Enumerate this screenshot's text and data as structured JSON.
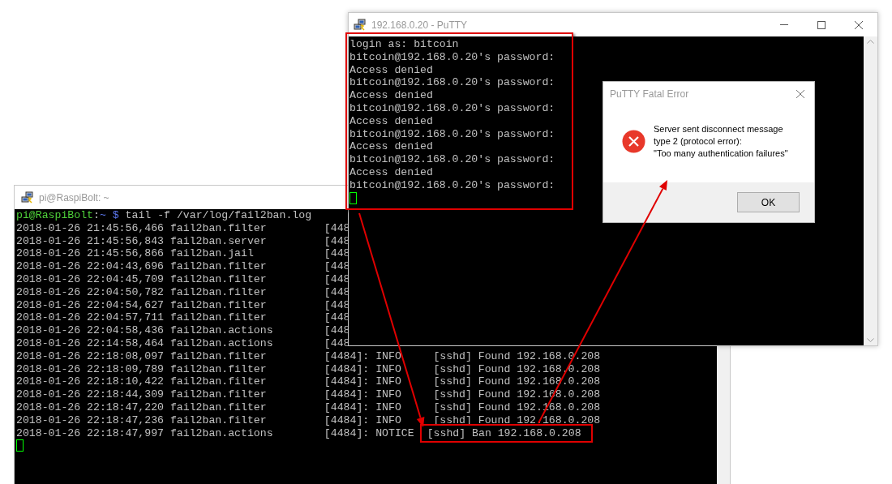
{
  "log_window": {
    "title": "pi@RaspiBolt: ~",
    "prompt": {
      "user_host": "pi@RaspiBolt",
      "separator": ":",
      "path": "~",
      "symbol": "$",
      "command": "tail -f /var/log/fail2ban.log"
    },
    "lines": [
      "2018-01-26 21:45:56,466 fail2ban.filter         [448",
      "2018-01-26 21:45:56,843 fail2ban.server         [448",
      "2018-01-26 21:45:56,866 fail2ban.jail           [448",
      "2018-01-26 22:04:43,696 fail2ban.filter         [448",
      "2018-01-26 22:04:45,709 fail2ban.filter         [448",
      "2018-01-26 22:04:50,782 fail2ban.filter         [448",
      "2018-01-26 22:04:54,627 fail2ban.filter         [448",
      "2018-01-26 22:04:57,711 fail2ban.filter         [448",
      "2018-01-26 22:04:58,436 fail2ban.actions        [448",
      "2018-01-26 22:14:58,464 fail2ban.actions        [448",
      "2018-01-26 22:18:08,097 fail2ban.filter         [4484]: INFO     [sshd] Found 192.168.0.208",
      "2018-01-26 22:18:09,789 fail2ban.filter         [4484]: INFO     [sshd] Found 192.168.0.208",
      "2018-01-26 22:18:10,422 fail2ban.filter         [4484]: INFO     [sshd] Found 192.168.0.208",
      "2018-01-26 22:18:44,309 fail2ban.filter         [4484]: INFO     [sshd] Found 192.168.0.208",
      "2018-01-26 22:18:47,220 fail2ban.filter         [4484]: INFO     [sshd] Found 192.168.0.208",
      "2018-01-26 22:18:47,236 fail2ban.filter         [4484]: INFO     [sshd] Found 192.168.0.208"
    ],
    "highlighted_line": {
      "lead": "2018-01-26 22:18:47,997 fail2ban.actions        [4484]: NOTICE",
      "highlighted": "[sshd] Ban 192.168.0.208"
    },
    "cursor": true
  },
  "putty_window": {
    "title": "192.168.0.20 - PuTTY",
    "lines": [
      "login as: bitcoin",
      "bitcoin@192.168.0.20's password:",
      "Access denied",
      "bitcoin@192.168.0.20's password:",
      "Access denied",
      "bitcoin@192.168.0.20's password:",
      "Access denied",
      "bitcoin@192.168.0.20's password:",
      "Access denied",
      "bitcoin@192.168.0.20's password:",
      "Access denied",
      "bitcoin@192.168.0.20's password:"
    ],
    "cursor": true
  },
  "error_dialog": {
    "title": "PuTTY Fatal Error",
    "message": [
      "Server sent disconnect message",
      "type 2 (protocol error):",
      "\"Too many authentication failures\""
    ],
    "button": "OK"
  }
}
